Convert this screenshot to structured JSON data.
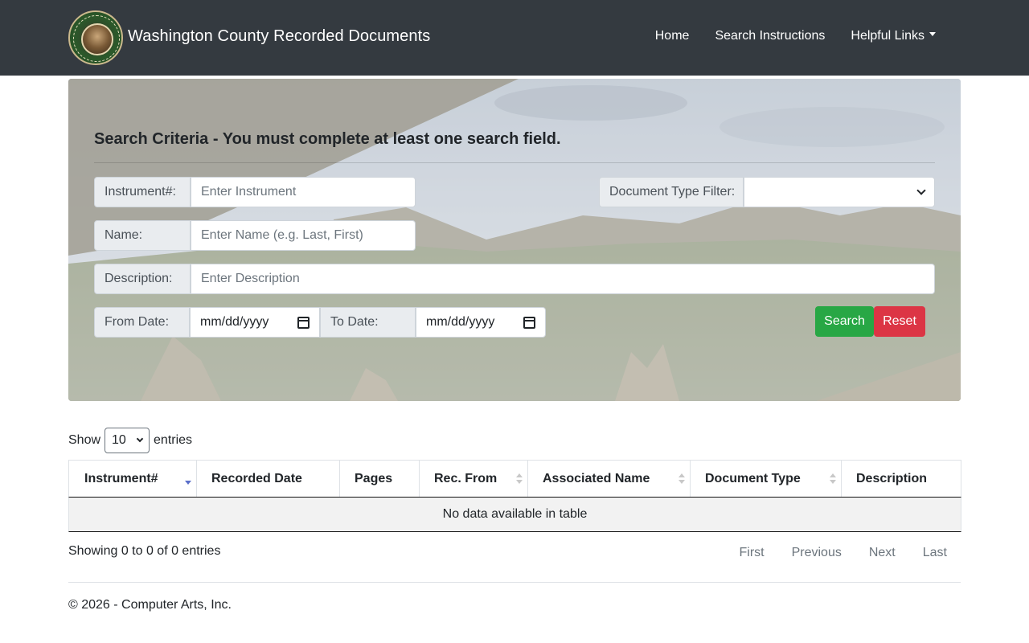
{
  "navbar": {
    "title": "Washington County Recorded Documents",
    "logo_text": "WASHINGTON COUNTY",
    "links": [
      "Home",
      "Search Instructions",
      "Helpful Links"
    ]
  },
  "search": {
    "title": "Search Criteria - You must complete at least one search field.",
    "instrument_label": "Instrument#:",
    "instrument_placeholder": "Enter Instrument",
    "doc_type_label": "Document Type Filter:",
    "doc_type_value": "",
    "name_label": "Name:",
    "name_placeholder": "Enter Name (e.g. Last, First)",
    "description_label": "Description:",
    "description_placeholder": "Enter Description",
    "from_date_label": "From Date:",
    "from_date_placeholder": "mm/dd/yyyy",
    "to_date_label": "To Date:",
    "to_date_placeholder": "mm/dd/yyyy",
    "search_button": "Search",
    "reset_button": "Reset"
  },
  "table": {
    "show_label": "Show",
    "entries_value": "10",
    "entries_label": "entries",
    "columns": [
      "Instrument#",
      "Recorded Date",
      "Pages",
      "Rec. From",
      "Associated Name",
      "Document Type",
      "Description"
    ],
    "empty_message": "No data available in table",
    "info": "Showing 0 to 0 of 0 entries",
    "pager": [
      "First",
      "Previous",
      "Next",
      "Last"
    ]
  },
  "footer": {
    "copyright": "© 2026 - Computer Arts, Inc."
  },
  "colors": {
    "navbar": "#343a40",
    "search_button": "#28a745",
    "reset_button": "#dc3545"
  }
}
